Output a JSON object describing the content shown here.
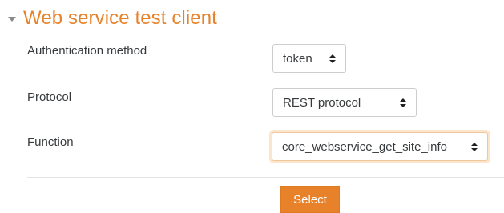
{
  "section": {
    "title": "Web service test client",
    "expanded_icon": "caret-down-icon"
  },
  "fields": {
    "authentication": {
      "label": "Authentication method",
      "value": "token"
    },
    "protocol": {
      "label": "Protocol",
      "value": "REST protocol"
    },
    "function": {
      "label": "Function",
      "value": "core_webservice_get_site_info"
    }
  },
  "actions": {
    "select_label": "Select"
  },
  "colors": {
    "accent": "#e8822a",
    "focus_ring": "#fbe5cd"
  }
}
